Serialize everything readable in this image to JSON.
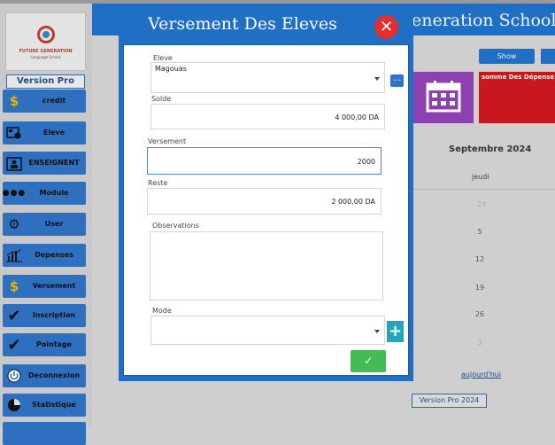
{
  "app": {
    "header_title": "eneration School"
  },
  "logo": {
    "brand": "FUTURE GENERATION",
    "subtitle": "Language School",
    "version": "Version Pro 2024"
  },
  "sidebar": {
    "items": [
      {
        "label": "credit",
        "icon": "dollar-icon"
      },
      {
        "label": "Eleve",
        "icon": "student-icon"
      },
      {
        "label": "ENSEIGNENT",
        "icon": "teacher-icon"
      },
      {
        "label": "Module",
        "icon": "dots-icon"
      },
      {
        "label": "User",
        "icon": "gears-icon"
      },
      {
        "label": "Depenses",
        "icon": "chart-icon"
      },
      {
        "label": "Versement",
        "icon": "dollar-icon"
      },
      {
        "label": "Inscription",
        "icon": "check-icon"
      },
      {
        "label": "Pointage",
        "icon": "check-icon"
      },
      {
        "label": "Deconnexion",
        "icon": "power-icon"
      },
      {
        "label": "Statistique",
        "icon": "pie-icon"
      }
    ]
  },
  "dashboard": {
    "show_label": "Show",
    "depenses_label": "somme Des Dépense",
    "calendar_month": "Septembre 2024",
    "weekday": "jeudi",
    "days": [
      "29",
      "5",
      "12",
      "19",
      "26",
      "3"
    ],
    "today_label": "aujourd'hui",
    "version_label": "Version Pro 2024"
  },
  "modal": {
    "title": "Versement Des Eleves",
    "close_symbol": "✕",
    "fields": {
      "eleve_label": "Eleve",
      "eleve_value": "Magouas",
      "solde_label": "Solde",
      "solde_value": "4 000,00 DA",
      "versement_label": "Versement",
      "versement_value": "2000",
      "reste_label": "Reste",
      "reste_value": "2 000,00 DA",
      "observations_label": "Observations",
      "observations_value": "",
      "mode_label": "Mode",
      "mode_value": ""
    },
    "dots_symbol": "...",
    "plus_symbol": "+",
    "ok_symbol": "✓"
  },
  "colors": {
    "primary": "#1f6fc4",
    "close": "#e4302d",
    "ok": "#45bb55",
    "plus": "#21a7b8",
    "tile_purple": "#8e3fb0",
    "tile_red": "#c8181d"
  }
}
